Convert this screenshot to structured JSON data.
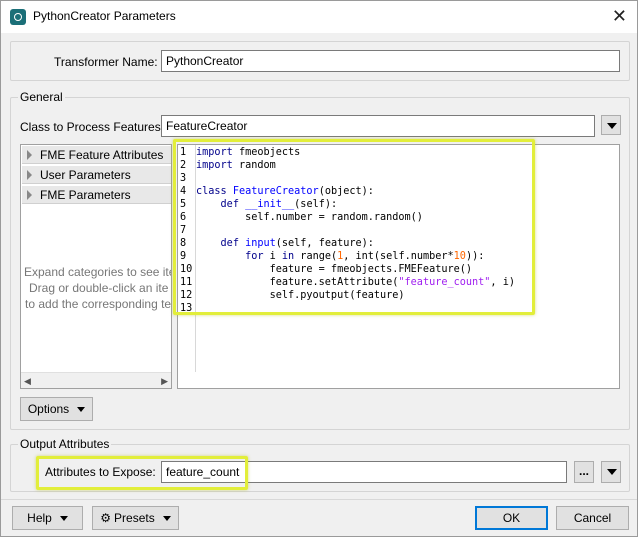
{
  "window": {
    "title": "PythonCreator Parameters",
    "close_glyph": "✕"
  },
  "transformer": {
    "label": "Transformer Name:",
    "value": "PythonCreator"
  },
  "general": {
    "group_title": "General",
    "class_label": "Class to Process Features:",
    "class_value": "FeatureCreator",
    "tree_items": [
      {
        "label": "FME Feature Attributes"
      },
      {
        "label": "User Parameters"
      },
      {
        "label": "FME Parameters"
      }
    ],
    "hint_lines": [
      "Expand categories to see ite",
      "Drag or double-click an ite",
      "to add the corresponding te"
    ],
    "options_label": "Options",
    "code_lines": [
      {
        "n": "1",
        "text": "import fmeobjects"
      },
      {
        "n": "2",
        "text": "import random"
      },
      {
        "n": "3",
        "text": ""
      },
      {
        "n": "4",
        "text": "class FeatureCreator(object):"
      },
      {
        "n": "5",
        "text": "    def __init__(self):"
      },
      {
        "n": "6",
        "text": "        self.number = random.random()"
      },
      {
        "n": "7",
        "text": ""
      },
      {
        "n": "8",
        "text": "    def input(self, feature):"
      },
      {
        "n": "9",
        "text": "        for i in range(1, int(self.number*10)):"
      },
      {
        "n": "10",
        "text": "            feature = fmeobjects.FMEFeature()"
      },
      {
        "n": "11",
        "text": "            feature.setAttribute(\"feature_count\", i)"
      },
      {
        "n": "12",
        "text": "            self.pyoutput(feature)"
      },
      {
        "n": "13",
        "text": ""
      }
    ]
  },
  "output": {
    "group_title": "Output Attributes",
    "expose_label": "Attributes to Expose:",
    "expose_value": "feature_count",
    "ellipsis_label": "..."
  },
  "footer": {
    "help_label": "Help",
    "presets_label": "Presets",
    "ok_label": "OK",
    "cancel_label": "Cancel"
  },
  "colors": {
    "highlight": "#e2ee3a",
    "ok_border": "#0078d7",
    "keyword": "#00008b",
    "string": "#a020f0",
    "number": "#ff6600"
  }
}
